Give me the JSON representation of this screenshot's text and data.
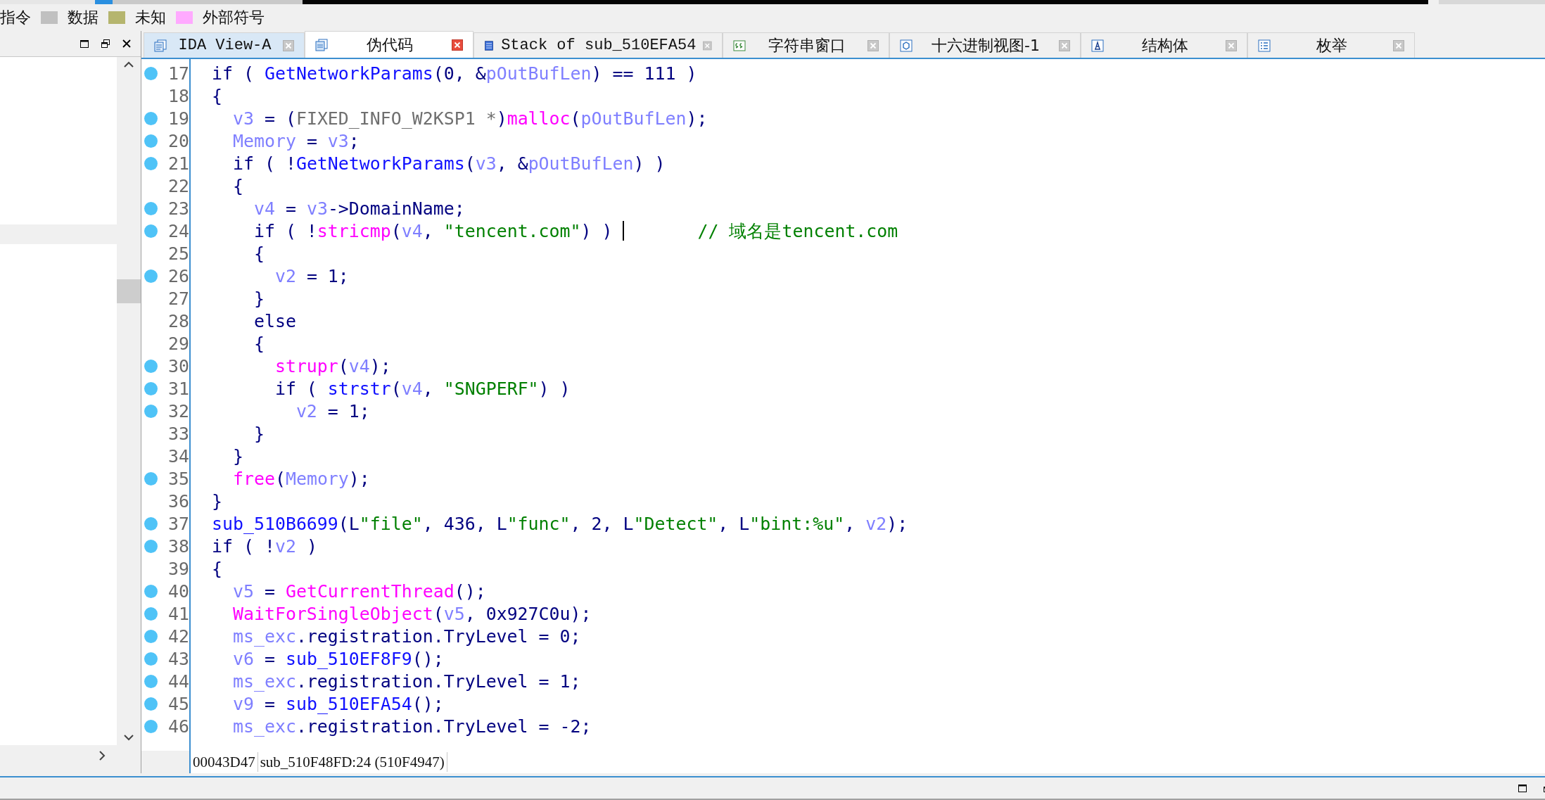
{
  "legend": [
    {
      "label": "指令"
    },
    {
      "label": "数据",
      "color": "#c0c0c0"
    },
    {
      "label": "未知",
      "color": "#b5b56e"
    },
    {
      "label": "外部符号",
      "color": "#ffaaff"
    }
  ],
  "tabs": [
    {
      "label": "IDA View-A",
      "selected": false
    },
    {
      "label": "伪代码",
      "selected": true
    },
    {
      "label": "Stack of sub_510EFA54",
      "selected": false
    },
    {
      "label": "字符串窗口",
      "selected": false
    },
    {
      "label": "十六进制视图-1",
      "selected": false
    },
    {
      "label": "结构体",
      "selected": false
    },
    {
      "label": "枚举",
      "selected": false
    }
  ],
  "lines": [
    {
      "number": "17",
      "breakpoint": true,
      "tokens": [
        {
          "kind": "plain",
          "text": "if ( "
        },
        {
          "kind": "func",
          "text": "GetNetworkParams"
        },
        {
          "kind": "plain",
          "text": "(0, &"
        },
        {
          "kind": "var",
          "text": "pOutBufLen"
        },
        {
          "kind": "plain",
          "text": ") == 111 )"
        }
      ]
    },
    {
      "number": "18",
      "breakpoint": false,
      "tokens": [
        {
          "kind": "plain",
          "text": "{"
        }
      ]
    },
    {
      "number": "19",
      "breakpoint": true,
      "tokens": [
        {
          "kind": "var",
          "text": "  v3"
        },
        {
          "kind": "plain",
          "text": " = ("
        },
        {
          "kind": "type",
          "text": "FIXED_INFO_W2KSP1 *"
        },
        {
          "kind": "plain",
          "text": ")"
        },
        {
          "kind": "import",
          "text": "malloc"
        },
        {
          "kind": "plain",
          "text": "("
        },
        {
          "kind": "var",
          "text": "pOutBufLen"
        },
        {
          "kind": "plain",
          "text": ");"
        }
      ]
    },
    {
      "number": "20",
      "breakpoint": true,
      "tokens": [
        {
          "kind": "var",
          "text": "  Memory"
        },
        {
          "kind": "plain",
          "text": " = "
        },
        {
          "kind": "var",
          "text": "v3"
        },
        {
          "kind": "plain",
          "text": ";"
        }
      ]
    },
    {
      "number": "21",
      "breakpoint": true,
      "tokens": [
        {
          "kind": "plain",
          "text": "  if ( !"
        },
        {
          "kind": "func",
          "text": "GetNetworkParams"
        },
        {
          "kind": "plain",
          "text": "("
        },
        {
          "kind": "var",
          "text": "v3"
        },
        {
          "kind": "plain",
          "text": ", &"
        },
        {
          "kind": "var",
          "text": "pOutBufLen"
        },
        {
          "kind": "plain",
          "text": ") )"
        }
      ]
    },
    {
      "number": "22",
      "breakpoint": false,
      "tokens": [
        {
          "kind": "plain",
          "text": "  {"
        }
      ]
    },
    {
      "number": "23",
      "breakpoint": true,
      "tokens": [
        {
          "kind": "var",
          "text": "    v4"
        },
        {
          "kind": "plain",
          "text": " = "
        },
        {
          "kind": "var",
          "text": "v3"
        },
        {
          "kind": "plain",
          "text": "->DomainName;"
        }
      ]
    },
    {
      "number": "24",
      "breakpoint": true,
      "caret": true,
      "comment": "// 域名是tencent.com",
      "tokens": [
        {
          "kind": "plain",
          "text": "    if ( !"
        },
        {
          "kind": "import",
          "text": "stricmp"
        },
        {
          "kind": "plain",
          "text": "("
        },
        {
          "kind": "var",
          "text": "v4"
        },
        {
          "kind": "plain",
          "text": ", "
        },
        {
          "kind": "string",
          "text": "\"tencent.com\""
        },
        {
          "kind": "plain",
          "text": ") )"
        }
      ]
    },
    {
      "number": "25",
      "breakpoint": false,
      "tokens": [
        {
          "kind": "plain",
          "text": "    {"
        }
      ]
    },
    {
      "number": "26",
      "breakpoint": true,
      "tokens": [
        {
          "kind": "var",
          "text": "      v2"
        },
        {
          "kind": "plain",
          "text": " = 1;"
        }
      ]
    },
    {
      "number": "27",
      "breakpoint": false,
      "tokens": [
        {
          "kind": "plain",
          "text": "    }"
        }
      ]
    },
    {
      "number": "28",
      "breakpoint": false,
      "tokens": [
        {
          "kind": "plain",
          "text": "    else"
        }
      ]
    },
    {
      "number": "29",
      "breakpoint": false,
      "tokens": [
        {
          "kind": "plain",
          "text": "    {"
        }
      ]
    },
    {
      "number": "30",
      "breakpoint": true,
      "tokens": [
        {
          "kind": "import",
          "text": "      strupr"
        },
        {
          "kind": "plain",
          "text": "("
        },
        {
          "kind": "var",
          "text": "v4"
        },
        {
          "kind": "plain",
          "text": ");"
        }
      ]
    },
    {
      "number": "31",
      "breakpoint": true,
      "tokens": [
        {
          "kind": "plain",
          "text": "      if ( "
        },
        {
          "kind": "func",
          "text": "strstr"
        },
        {
          "kind": "plain",
          "text": "("
        },
        {
          "kind": "var",
          "text": "v4"
        },
        {
          "kind": "plain",
          "text": ", "
        },
        {
          "kind": "string",
          "text": "\"SNGPERF\""
        },
        {
          "kind": "plain",
          "text": ") )"
        }
      ]
    },
    {
      "number": "32",
      "breakpoint": true,
      "tokens": [
        {
          "kind": "var",
          "text": "        v2"
        },
        {
          "kind": "plain",
          "text": " = 1;"
        }
      ]
    },
    {
      "number": "33",
      "breakpoint": false,
      "tokens": [
        {
          "kind": "plain",
          "text": "    }"
        }
      ]
    },
    {
      "number": "34",
      "breakpoint": false,
      "tokens": [
        {
          "kind": "plain",
          "text": "  }"
        }
      ]
    },
    {
      "number": "35",
      "breakpoint": true,
      "tokens": [
        {
          "kind": "import",
          "text": "  free"
        },
        {
          "kind": "plain",
          "text": "("
        },
        {
          "kind": "var",
          "text": "Memory"
        },
        {
          "kind": "plain",
          "text": ");"
        }
      ]
    },
    {
      "number": "36",
      "breakpoint": false,
      "tokens": [
        {
          "kind": "plain",
          "text": "}"
        }
      ]
    },
    {
      "number": "37",
      "breakpoint": true,
      "tokens": [
        {
          "kind": "func",
          "text": "sub_510B6699"
        },
        {
          "kind": "plain",
          "text": "(L"
        },
        {
          "kind": "string",
          "text": "\"file\""
        },
        {
          "kind": "plain",
          "text": ", 436, L"
        },
        {
          "kind": "string",
          "text": "\"func\""
        },
        {
          "kind": "plain",
          "text": ", 2, L"
        },
        {
          "kind": "string",
          "text": "\"Detect\""
        },
        {
          "kind": "plain",
          "text": ", L"
        },
        {
          "kind": "string",
          "text": "\"bint:%u\""
        },
        {
          "kind": "plain",
          "text": ", "
        },
        {
          "kind": "var",
          "text": "v2"
        },
        {
          "kind": "plain",
          "text": ");"
        }
      ]
    },
    {
      "number": "38",
      "breakpoint": true,
      "tokens": [
        {
          "kind": "plain",
          "text": "if ( !"
        },
        {
          "kind": "var",
          "text": "v2"
        },
        {
          "kind": "plain",
          "text": " )"
        }
      ]
    },
    {
      "number": "39",
      "breakpoint": false,
      "tokens": [
        {
          "kind": "plain",
          "text": "{"
        }
      ]
    },
    {
      "number": "40",
      "breakpoint": true,
      "tokens": [
        {
          "kind": "var",
          "text": "  v5"
        },
        {
          "kind": "plain",
          "text": " = "
        },
        {
          "kind": "import",
          "text": "GetCurrentThread"
        },
        {
          "kind": "plain",
          "text": "();"
        }
      ]
    },
    {
      "number": "41",
      "breakpoint": true,
      "tokens": [
        {
          "kind": "import",
          "text": "  WaitForSingleObject"
        },
        {
          "kind": "plain",
          "text": "("
        },
        {
          "kind": "var",
          "text": "v5"
        },
        {
          "kind": "plain",
          "text": ", 0x927C0u);"
        }
      ]
    },
    {
      "number": "42",
      "breakpoint": true,
      "tokens": [
        {
          "kind": "var",
          "text": "  ms_exc"
        },
        {
          "kind": "plain",
          "text": ".registration.TryLevel = 0;"
        }
      ]
    },
    {
      "number": "43",
      "breakpoint": true,
      "tokens": [
        {
          "kind": "var",
          "text": "  v6"
        },
        {
          "kind": "plain",
          "text": " = "
        },
        {
          "kind": "func",
          "text": "sub_510EF8F9"
        },
        {
          "kind": "plain",
          "text": "();"
        }
      ]
    },
    {
      "number": "44",
      "breakpoint": true,
      "tokens": [
        {
          "kind": "var",
          "text": "  ms_exc"
        },
        {
          "kind": "plain",
          "text": ".registration.TryLevel = 1;"
        }
      ]
    },
    {
      "number": "45",
      "breakpoint": true,
      "tokens": [
        {
          "kind": "var",
          "text": "  v9"
        },
        {
          "kind": "plain",
          "text": " = "
        },
        {
          "kind": "func",
          "text": "sub_510EFA54"
        },
        {
          "kind": "plain",
          "text": "();"
        }
      ]
    },
    {
      "number": "46",
      "breakpoint": true,
      "tokens": [
        {
          "kind": "var",
          "text": "  ms_exc"
        },
        {
          "kind": "plain",
          "text": ".registration.TryLevel = -2;"
        }
      ]
    }
  ],
  "status_bar": {
    "address": "00043D47",
    "location": "sub_510F48FD:24 (510F4947)"
  }
}
